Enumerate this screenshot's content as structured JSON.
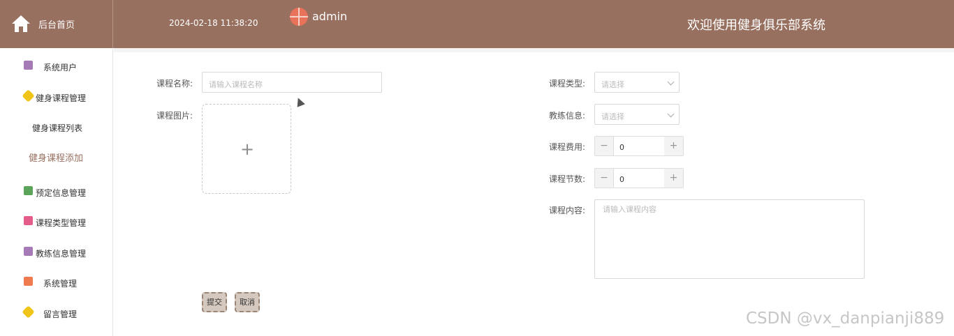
{
  "header": {
    "home_label": "后台首页",
    "datetime": "2024-02-18 11:38:20",
    "username": "admin",
    "system_title": "欢迎使用健身俱乐部系统"
  },
  "sidebar": {
    "items": [
      {
        "label": "系统用户",
        "icon": "archive-icon",
        "color": "#a57ab7"
      },
      {
        "label": "健身课程管理",
        "icon": "cube-icon",
        "color": "#f0c419"
      },
      {
        "label": "预定信息管理",
        "icon": "message-icon",
        "color": "#5aa55a"
      },
      {
        "label": "课程类型管理",
        "icon": "bag-icon",
        "color": "#e45c8a"
      },
      {
        "label": "教练信息管理",
        "icon": "archive-icon",
        "color": "#a57ab7"
      },
      {
        "label": "系统管理",
        "icon": "grid-icon",
        "color": "#ef7a4f"
      },
      {
        "label": "留言管理",
        "icon": "cube-icon",
        "color": "#f0c419"
      }
    ],
    "submenu": {
      "list": "健身课程列表",
      "add": "健身课程添加"
    }
  },
  "form": {
    "course_name_label": "课程名称:",
    "course_name_placeholder": "请输入课程名称",
    "course_image_label": "课程图片:",
    "course_type_label": "课程类型:",
    "course_type_placeholder": "请选择",
    "coach_info_label": "教练信息:",
    "coach_info_placeholder": "请选择",
    "course_fee_label": "课程费用:",
    "course_fee_value": "0",
    "course_sessions_label": "课程节数:",
    "course_sessions_value": "0",
    "course_content_label": "课程内容:",
    "course_content_placeholder": "请输入课程内容",
    "submit_label": "提交",
    "cancel_label": "取消"
  },
  "watermark": "CSDN @vx_danpianji889",
  "colors": {
    "header_bg": "#987060",
    "active_submenu": "#987060",
    "button_bg": "#d5c9bf"
  }
}
